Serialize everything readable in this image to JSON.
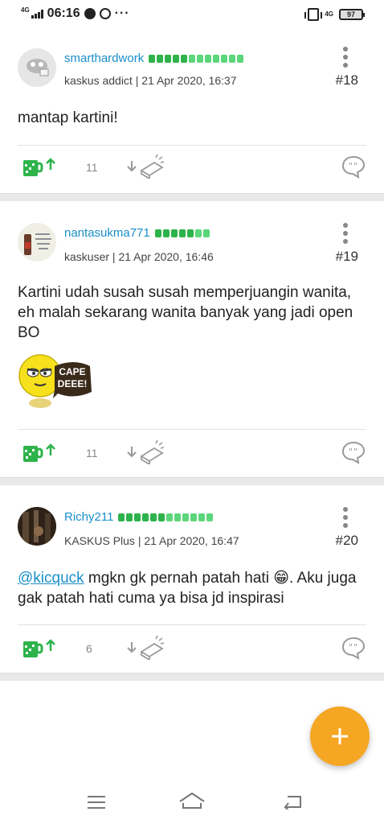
{
  "status_bar": {
    "network": "4G",
    "time": "06:16",
    "more": "···",
    "network_right": "4G",
    "battery": "97"
  },
  "posts": [
    {
      "username": "smarthardwork",
      "rank": "kaskus addict",
      "date": "21 Apr 2020, 16:37",
      "number": "#18",
      "content": "mantap kartini!",
      "cendol_count": "11",
      "rep_colors": [
        "#2db34a",
        "#2db34a",
        "#2db34a",
        "#2db34a",
        "#2db34a",
        "#5cd67a",
        "#5cd67a",
        "#5cd67a",
        "#5cd67a",
        "#5cd67a",
        "#5cd67a",
        "#5cd67a"
      ]
    },
    {
      "username": "nantasukma771",
      "rank": "kaskuser",
      "date": "21 Apr 2020, 16:46",
      "number": "#19",
      "content": "Kartini udah susah susah memperjuangin wanita, eh malah sekarang wanita banyak yang jadi open BO",
      "sticker_text": "CAPE DEEE!",
      "cendol_count": "11",
      "rep_colors": [
        "#2db34a",
        "#2db34a",
        "#2db34a",
        "#2db34a",
        "#2db34a",
        "#5cd67a",
        "#5cd67a"
      ]
    },
    {
      "username": "Richy211",
      "rank": "KASKUS Plus",
      "date": "21 Apr 2020, 16:47",
      "number": "#20",
      "mention": "@kicquck",
      "content_a": " mgkn gk pernah patah hati ",
      "emoji": "😁",
      "content_b": ". Aku juga gak patah hati cuma ya bisa jd inspirasi",
      "cendol_count": "6",
      "rep_colors": [
        "#2db34a",
        "#2db34a",
        "#2db34a",
        "#2db34a",
        "#2db34a",
        "#2db34a",
        "#5cd67a",
        "#5cd67a",
        "#5cd67a",
        "#5cd67a",
        "#5cd67a",
        "#5cd67a"
      ]
    }
  ],
  "meta_separator": " | ",
  "colors": {
    "accent": "#1a8fc9",
    "cendol": "#2db34a",
    "fab": "#f5a623"
  },
  "icons": [
    "more-vertical-icon",
    "cendol-icon",
    "arrow-up-icon",
    "arrow-down-icon",
    "bata-icon",
    "comment-icon",
    "plus-icon",
    "menu-icon",
    "home-icon",
    "back-icon"
  ]
}
